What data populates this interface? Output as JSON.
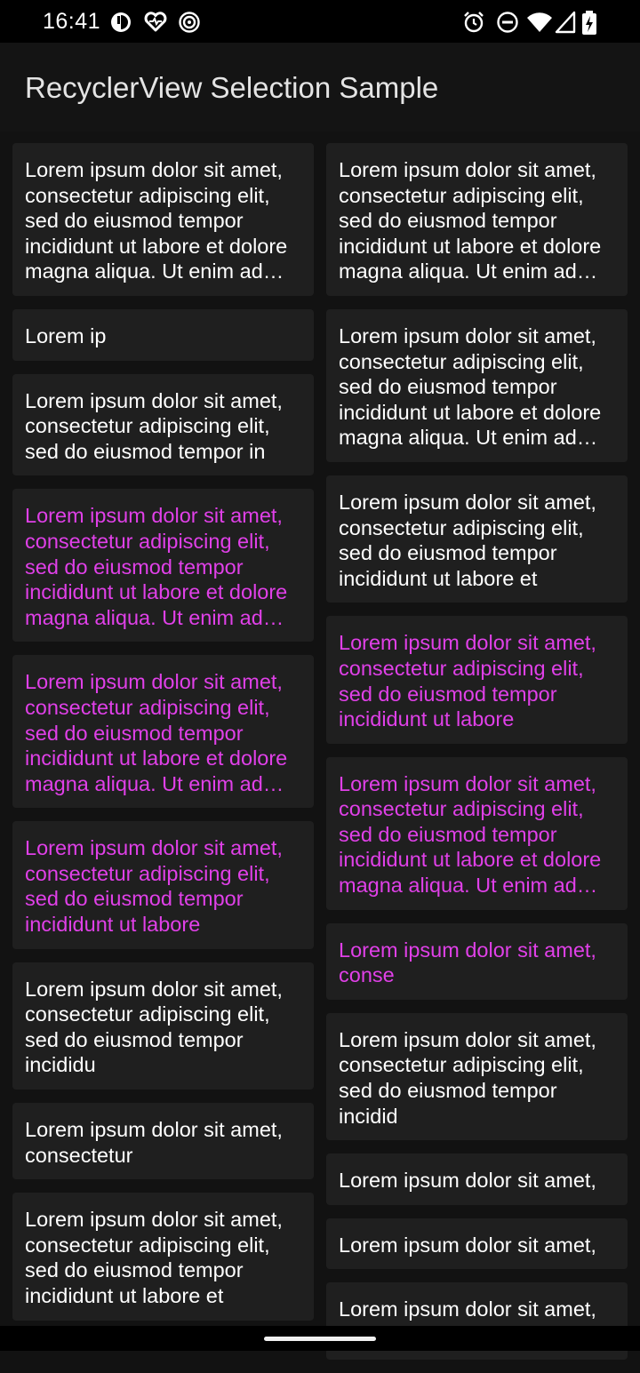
{
  "status_bar": {
    "time": "16:41",
    "left_icons": [
      "data-saver-icon",
      "heart-rate-icon",
      "fingerprint-icon"
    ],
    "right_icons": [
      "alarm-icon",
      "do-not-disturb-icon",
      "wifi-icon",
      "cellular-signal-icon",
      "battery-charging-icon"
    ]
  },
  "app_bar": {
    "title": "RecyclerView Selection Sample"
  },
  "colors": {
    "selected_text": "#e040e8",
    "normal_text": "#ffffff",
    "card_bg": "#1f1f1f",
    "background": "#121212"
  },
  "grid": {
    "left": [
      {
        "text": "Lorem ipsum dolor sit amet, consectetur adipiscing elit, sed do eiusmod tempor incididunt ut labore et dolore magna aliqua. Ut enim ad minim veniam",
        "lines": 5,
        "selected": false
      },
      {
        "text": "Lorem ip",
        "lines": 1,
        "selected": false
      },
      {
        "text": "Lorem ipsum dolor sit amet, consectetur adipiscing elit, sed do eiusmod tempor in",
        "lines": 3,
        "selected": false
      },
      {
        "text": "Lorem ipsum dolor sit amet, consectetur adipiscing elit, sed do eiusmod tempor incididunt ut labore et dolore magna aliqua. Ut enim ad minim veniam",
        "lines": 5,
        "selected": true
      },
      {
        "text": "Lorem ipsum dolor sit amet, consectetur adipiscing elit, sed do eiusmod tempor incididunt ut labore et dolore magna aliqua. Ut enim ad minim veniam",
        "lines": 5,
        "selected": true
      },
      {
        "text": "Lorem ipsum dolor sit amet, consectetur adipiscing elit, sed do eiusmod tempor incididunt ut labore",
        "lines": 4,
        "selected": true
      },
      {
        "text": "Lorem ipsum dolor sit amet, consectetur adipiscing elit, sed do eiusmod tempor incididu",
        "lines": 4,
        "selected": false
      },
      {
        "text": "Lorem ipsum dolor sit amet, consectetur",
        "lines": 2,
        "selected": false
      },
      {
        "text": "Lorem ipsum dolor sit amet, consectetur adipiscing elit, sed do eiusmod tempor incididunt ut labore et",
        "lines": 4,
        "selected": false
      }
    ],
    "right": [
      {
        "text": "Lorem ipsum dolor sit amet, consectetur adipiscing elit, sed do eiusmod tempor incididunt ut labore et dolore magna aliqua. Ut enim ad minim veniam",
        "lines": 5,
        "selected": false
      },
      {
        "text": "Lorem ipsum dolor sit amet, consectetur adipiscing elit, sed do eiusmod tempor incididunt ut labore et dolore magna aliqua. Ut enim ad minim veniam",
        "lines": 5,
        "selected": false
      },
      {
        "text": "Lorem ipsum dolor sit amet, consectetur adipiscing elit, sed do eiusmod tempor incididunt ut labore et",
        "lines": 4,
        "selected": false
      },
      {
        "text": "Lorem ipsum dolor sit amet, consectetur adipiscing elit, sed do eiusmod tempor incididunt ut labore",
        "lines": 4,
        "selected": true
      },
      {
        "text": "Lorem ipsum dolor sit amet, consectetur adipiscing elit, sed do eiusmod tempor incididunt ut labore et dolore magna aliqua. Ut enim ad minim veniam",
        "lines": 5,
        "selected": true
      },
      {
        "text": "Lorem ipsum dolor sit amet, conse",
        "lines": 2,
        "selected": true
      },
      {
        "text": "Lorem ipsum dolor sit amet, consectetur adipiscing elit, sed do eiusmod tempor incidid",
        "lines": 4,
        "selected": false
      },
      {
        "text": "Lorem ipsum dolor sit amet,",
        "lines": 1,
        "selected": false
      },
      {
        "text": "Lorem ipsum dolor sit amet,",
        "lines": 1,
        "selected": false
      },
      {
        "text": "Lorem ipsum dolor sit amet, consectetur adipiscing elit",
        "lines": 2,
        "selected": false
      }
    ]
  }
}
